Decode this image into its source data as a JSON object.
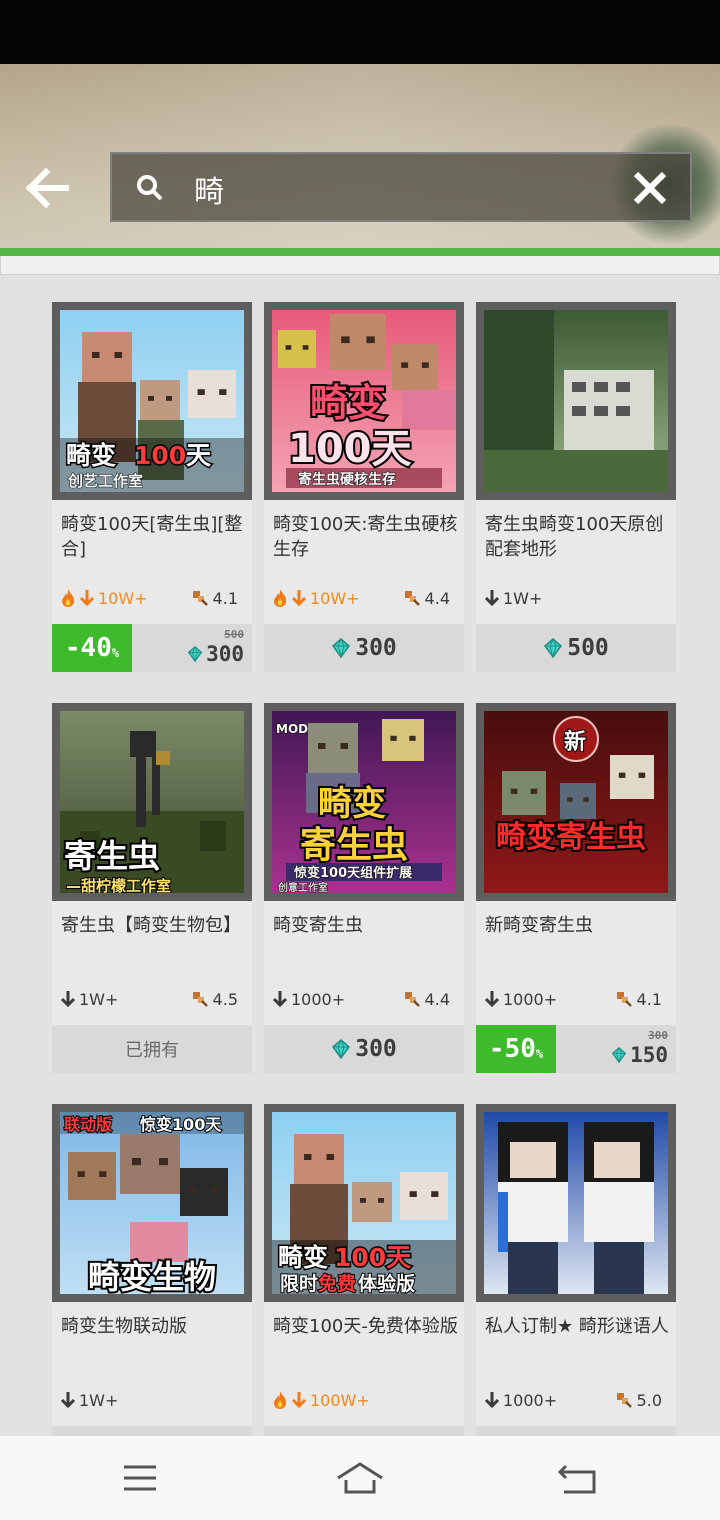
{
  "search": {
    "value": "畸",
    "placeholder": ""
  },
  "icons": {
    "back": "arrow-left-icon",
    "search": "search-icon",
    "clear": "close-icon",
    "hot": "fire-icon",
    "download": "download-arrow-icon",
    "rating": "rating-icon",
    "diamond": "diamond-icon",
    "menu": "menu-icon",
    "home": "home-icon",
    "back_nav": "back-icon"
  },
  "colors": {
    "accent": "#56b648",
    "discount": "#3fba2c",
    "hot": "#f08a1d",
    "diamond": "#3fd1c3"
  },
  "items": [
    {
      "title": "畸变100天[寄生虫][整合]",
      "downloads": "10W+",
      "hot": true,
      "rating": "4.1",
      "price": {
        "type": "discount",
        "discount": "-40",
        "pct": "%",
        "old": "500",
        "new": "300"
      },
      "thumb": {
        "bg1": "#8fd0f2",
        "bg2": "#c9e7f3",
        "l1": "畸变",
        "l1b": "100",
        "l1c": "天",
        "l2": "创艺工作室"
      }
    },
    {
      "title": "畸变100天:寄生虫硬核生存",
      "downloads": "10W+",
      "hot": true,
      "rating": "4.4",
      "price": {
        "type": "price",
        "value": "300"
      },
      "thumb": {
        "bg1": "#e75b7a",
        "bg2": "#f4a3b3",
        "l1": "畸变",
        "l2": "100天",
        "l3": "寄生虫硬核生存"
      }
    },
    {
      "title": "寄生虫畸变100天原创配套地形",
      "downloads": "1W+",
      "hot": false,
      "rating": "",
      "price": {
        "type": "price",
        "value": "500"
      },
      "thumb": {
        "bg1": "#3c5a34",
        "bg2": "#9db58c"
      }
    },
    {
      "title": "寄生虫【畸变生物包】",
      "downloads": "1W+",
      "hot": false,
      "rating": "4.5",
      "price": {
        "type": "owned",
        "label": "已拥有"
      },
      "thumb": {
        "bg1": "#7d8a6a",
        "bg2": "#3e4a2c",
        "l1": "寄生虫",
        "l2": "—甜柠檬工作室"
      }
    },
    {
      "title": "畸变寄生虫",
      "downloads": "1000+",
      "hot": false,
      "rating": "4.4",
      "price": {
        "type": "price",
        "value": "300"
      },
      "thumb": {
        "bg1": "#3a1a4e",
        "bg2": "#d23fa4",
        "l1": "畸变",
        "l2": "寄生虫",
        "l3": "惊变100天组件扩展",
        "tag": "MOD",
        "l4": "创意工作室"
      }
    },
    {
      "title": "新畸变寄生虫",
      "downloads": "1000+",
      "hot": false,
      "rating": "4.1",
      "price": {
        "type": "discount",
        "discount": "-50",
        "pct": "%",
        "old": "300",
        "new": "150"
      },
      "thumb": {
        "bg1": "#2b0c0c",
        "bg2": "#8a1a1a",
        "l1": "畸变寄生虫",
        "badge": "新"
      }
    },
    {
      "title": "畸变生物联动版",
      "downloads": "1W+",
      "hot": false,
      "rating": "",
      "price": {
        "type": "none"
      },
      "thumb": {
        "bg1": "#7fb7e8",
        "bg2": "#bfe0f4",
        "l1": "畸变生物",
        "t1": "联动版",
        "t2": "惊变100天"
      }
    },
    {
      "title": "畸变100天-免费体验版",
      "downloads": "100W+",
      "hot": true,
      "rating": "",
      "price": {
        "type": "none"
      },
      "thumb": {
        "bg1": "#8fd0f2",
        "bg2": "#c9e7f3",
        "l1": "畸变",
        "l1b": "100天",
        "l2": "限时",
        "l2b": "免费",
        "l2c": "体验版"
      }
    },
    {
      "title": "私人订制★ 畸形谜语人",
      "downloads": "1000+",
      "hot": false,
      "rating": "5.0",
      "price": {
        "type": "none"
      },
      "thumb": {
        "bg1": "#1f4aa8",
        "bg2": "#dfe6f2"
      }
    }
  ]
}
